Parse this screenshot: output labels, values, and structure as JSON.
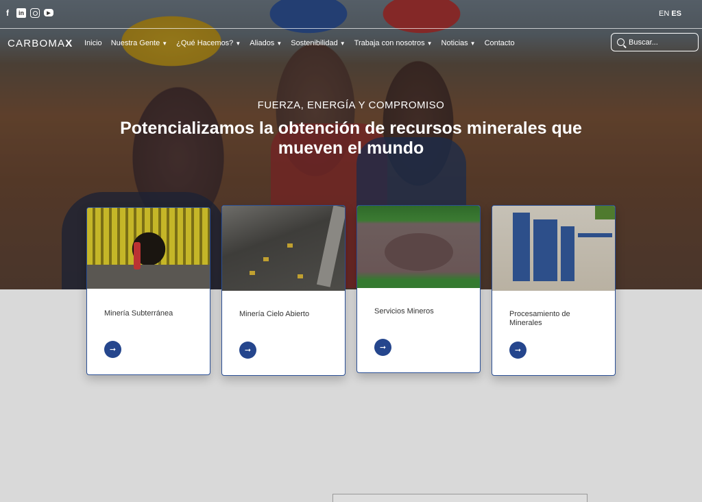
{
  "topbar": {
    "social": [
      "facebook-icon",
      "linkedin-icon",
      "instagram-icon",
      "youtube-icon"
    ],
    "lang_en": "EN",
    "lang_es": "ES"
  },
  "nav": {
    "logo_left": "CARBOMA",
    "logo_right": "X",
    "items": [
      {
        "label": "Inicio",
        "dropdown": false
      },
      {
        "label": "Nuestra Gente",
        "dropdown": true
      },
      {
        "label": "¿Qué Hacemos?",
        "dropdown": true
      },
      {
        "label": "Aliados",
        "dropdown": true
      },
      {
        "label": "Sostenibilidad",
        "dropdown": true
      },
      {
        "label": "Trabaja con nosotros",
        "dropdown": true
      },
      {
        "label": "Noticias",
        "dropdown": true
      },
      {
        "label": "Contacto",
        "dropdown": false
      }
    ],
    "caret": "▼",
    "search_placeholder": "Buscar..."
  },
  "hero": {
    "tagline": "FUERZA, ENERGÍA Y COMPROMISO",
    "headline_line1": "Potencializamos la obtención de recursos minerales que",
    "headline_line2": "mueven el mundo"
  },
  "cards": [
    {
      "title": "Minería Subterránea",
      "arrow": "➞"
    },
    {
      "title": "Minería Cielo Abierto",
      "arrow": "➞"
    },
    {
      "title": "Servicios Mineros",
      "arrow": "➞"
    },
    {
      "title": "Procesamiento de Minerales",
      "arrow": "➞"
    }
  ],
  "colors": {
    "accent": "#25468d",
    "card_border": "#2a4f95",
    "page_bg": "#d9d9d9"
  }
}
